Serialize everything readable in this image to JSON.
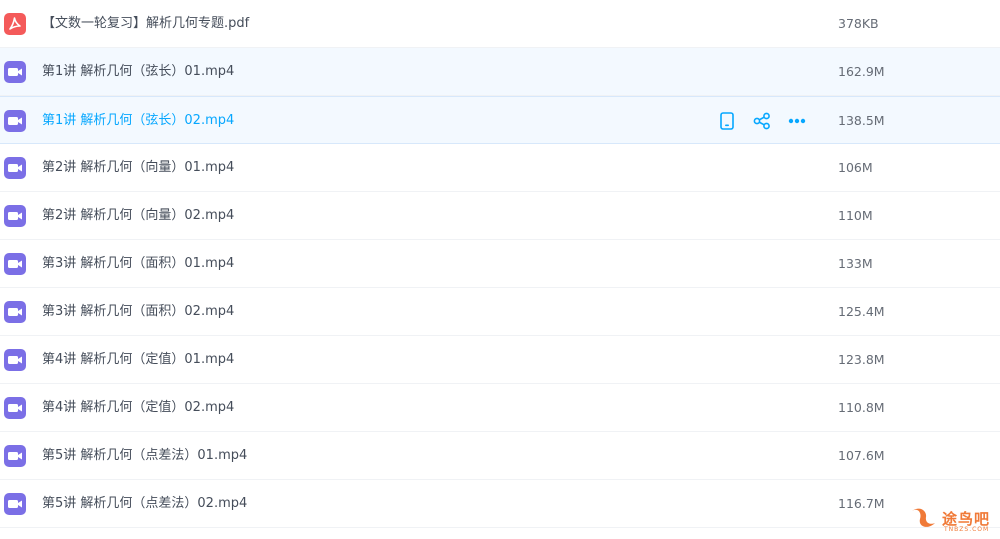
{
  "colors": {
    "pdf_icon": "#f45a5a",
    "video_icon": "#7b6fe6",
    "accent": "#06a7ff",
    "watermark": "#f07a38"
  },
  "files": [
    {
      "name": "【文数一轮复习】解析几何专题.pdf",
      "size": "378KB",
      "type": "pdf",
      "icon": "pdf-icon"
    },
    {
      "name": "第1讲 解析几何（弦长）01.mp4",
      "size": "162.9M",
      "type": "video",
      "icon": "video-icon"
    },
    {
      "name": "第1讲 解析几何（弦长）02.mp4",
      "size": "138.5M",
      "type": "video",
      "icon": "video-icon",
      "active": true
    },
    {
      "name": "第2讲 解析几何（向量）01.mp4",
      "size": "106M",
      "type": "video",
      "icon": "video-icon"
    },
    {
      "name": "第2讲 解析几何（向量）02.mp4",
      "size": "110M",
      "type": "video",
      "icon": "video-icon"
    },
    {
      "name": "第3讲 解析几何（面积）01.mp4",
      "size": "133M",
      "type": "video",
      "icon": "video-icon"
    },
    {
      "name": "第3讲 解析几何（面积）02.mp4",
      "size": "125.4M",
      "type": "video",
      "icon": "video-icon"
    },
    {
      "name": "第4讲 解析几何（定值）01.mp4",
      "size": "123.8M",
      "type": "video",
      "icon": "video-icon"
    },
    {
      "name": "第4讲 解析几何（定值）02.mp4",
      "size": "110.8M",
      "type": "video",
      "icon": "video-icon"
    },
    {
      "name": "第5讲 解析几何（点差法）01.mp4",
      "size": "107.6M",
      "type": "video",
      "icon": "video-icon"
    },
    {
      "name": "第5讲 解析几何（点差法）02.mp4",
      "size": "116.7M",
      "type": "video",
      "icon": "video-icon"
    }
  ],
  "row_actions": [
    "phone-icon",
    "share-icon",
    "more-icon"
  ],
  "watermark": {
    "text": "途鸟吧",
    "sub": "TNBZS.COM"
  }
}
